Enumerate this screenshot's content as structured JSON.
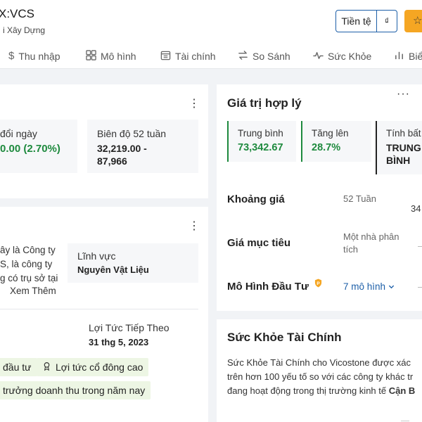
{
  "header": {
    "ticker": "X:VCS",
    "industry": "i Xây Dựng",
    "currency_label": "Tiền tệ",
    "currency_symbol": "₫",
    "star_icon": "star-icon"
  },
  "nav": {
    "items": [
      {
        "label": "Thu nhập",
        "icon": "dollar-icon"
      },
      {
        "label": "Mô hình",
        "icon": "grid-icon"
      },
      {
        "label": "Tài chính",
        "icon": "calendar-icon"
      },
      {
        "label": "So Sánh",
        "icon": "compare-icon"
      },
      {
        "label": "Sức Khỏe",
        "icon": "pulse-icon"
      },
      {
        "label": "Biể",
        "icon": "bar-chart-icon"
      }
    ]
  },
  "left_top": {
    "daily_change_label": "đổi ngày",
    "daily_change_value": "0.00 (2.70%)",
    "range52_label": "Biên độ 52 tuần",
    "range52_value_line1": "32,219.00 -",
    "range52_value_line2": "87,966"
  },
  "profile": {
    "desc_line1": "ây là Công ty",
    "desc_line2": "S, là công ty",
    "desc_line3": "g có trụ sở tại",
    "see_more": "Xem Thêm",
    "sector_label": "Lĩnh vực",
    "sector_value": "Nguyên Vật Liệu",
    "next_dividend_label": "Lợi Tức Tiếp Theo",
    "next_dividend_value": "31 thg 5, 2023",
    "tags": [
      "đầu tư",
      "Lợi tức cổ đông cao",
      "trưởng doanh thu trong năm nay"
    ]
  },
  "fair_value": {
    "title": "Giá trị hợp lý",
    "avg_label": "Trung bình",
    "avg_value": "73,342.67",
    "upside_label": "Tăng lên",
    "upside_value": "28.7%",
    "calc_label": "Tính bất",
    "calc_value_line1": "TRUNG",
    "calc_value_line2": "BÌNH",
    "price_range_label": "Khoảng giá",
    "price_range_sub": "52 Tuần",
    "price_range_partial": "34",
    "target_label": "Giá mục tiêu",
    "target_sub_line1": "Một nhà phân",
    "target_sub_line2": "tích",
    "model_label": "Mô Hình Đầu Tư",
    "model_link": "7 mô hình"
  },
  "health": {
    "title": "Sức Khỏe Tài Chính",
    "line1": "Sức Khỏe Tài Chính cho Vicostone được xác",
    "line2": "trên hơn 100 yếu tố so với các công ty khác tr",
    "line3_prefix": "đang hoạt động trong thị trường kinh tế ",
    "line3_bold": "Cận B"
  },
  "colors": {
    "accent_blue": "#1d5fa8",
    "positive_green": "#1e8a3e",
    "star_orange": "#f5a623"
  }
}
